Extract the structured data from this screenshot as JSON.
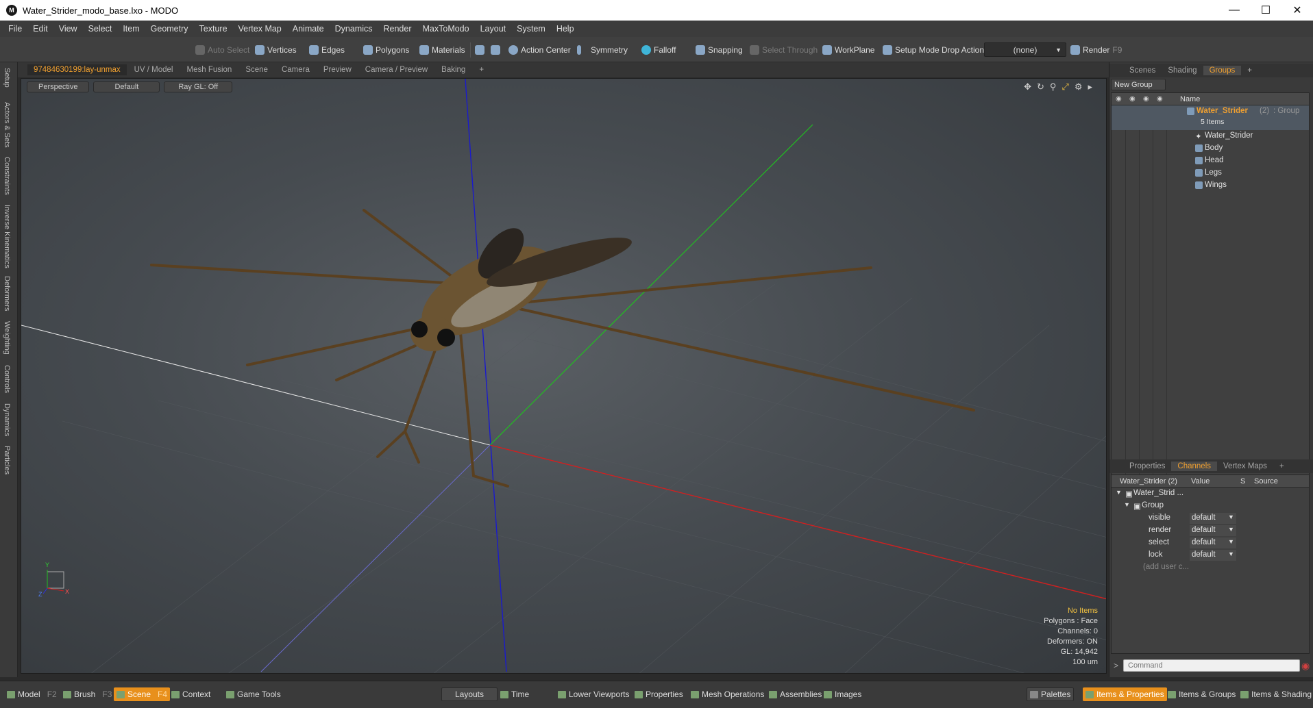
{
  "window": {
    "title": "Water_Strider_modo_base.lxo - MODO",
    "logo": "M"
  },
  "menu": [
    "File",
    "Edit",
    "View",
    "Select",
    "Item",
    "Geometry",
    "Texture",
    "Vertex Map",
    "Animate",
    "Dynamics",
    "Render",
    "MaxToModo",
    "Layout",
    "System",
    "Help"
  ],
  "toolbar": {
    "auto_select": "Auto Select",
    "vertices": "Vertices",
    "edges": "Edges",
    "polygons": "Polygons",
    "materials": "Materials",
    "action_center": "Action Center",
    "symmetry": "Symmetry",
    "falloff": "Falloff",
    "snapping": "Snapping",
    "select_through": "Select Through",
    "workplane": "WorkPlane",
    "setup_mode": "Setup Mode",
    "drop_action": "Drop Action",
    "drop_value": "(none)",
    "render": "Render",
    "render_key": "F9"
  },
  "left_tabs": [
    "Setup",
    "Actors & Sets",
    "Constraints",
    "Inverse Kinematics",
    "Deformers",
    "Weighting",
    "Controls",
    "Dynamics",
    "Particles"
  ],
  "viewport_tabs": [
    "97484630199:lay-unmax",
    "UV / Model",
    "Mesh Fusion",
    "Scene",
    "Camera",
    "Preview",
    "Camera / Preview",
    "Baking",
    "+"
  ],
  "viewport": {
    "view": "Perspective",
    "shading": "Default",
    "raygl": "Ray GL: Off",
    "info": {
      "items": "No Items",
      "polygons": "Polygons : Face",
      "channels": "Channels: 0",
      "deformers": "Deformers: ON",
      "gl": "GL: 14,942",
      "unit": "100 um"
    },
    "axis_labels": {
      "y": "Y",
      "z": "Z",
      "x": "X"
    }
  },
  "right_panel": {
    "top_tabs": [
      "Scenes",
      "Shading",
      "Groups",
      "+"
    ],
    "new_group": "New Group",
    "tree_header": "Name",
    "group": {
      "name": "Water_Strider",
      "count": "(2)",
      "type": ": Group",
      "sub": "5 Items"
    },
    "items": [
      "Water_Strider",
      "Body",
      "Head",
      "Legs",
      "Wings"
    ],
    "bottom_tabs": [
      "Properties",
      "Channels",
      "Vertex Maps",
      "+"
    ],
    "channels": {
      "header": {
        "name": "Water_Strider (2)",
        "value": "Value",
        "s": "S",
        "source": "Source"
      },
      "root": "Water_Strid ...",
      "group": "Group",
      "rows": [
        {
          "name": "visible",
          "value": "default"
        },
        {
          "name": "render",
          "value": "default"
        },
        {
          "name": "select",
          "value": "default"
        },
        {
          "name": "lock",
          "value": "default"
        }
      ],
      "add": "(add user c..."
    },
    "command_placeholder": "Command"
  },
  "bottom": {
    "model": "Model",
    "model_key": "F2",
    "brush": "Brush",
    "brush_key": "F3",
    "scene": "Scene",
    "scene_key": "F4",
    "context": "Context",
    "game_tools": "Game Tools",
    "layouts": "Layouts",
    "time": "Time",
    "lower_viewports": "Lower Viewports",
    "properties": "Properties",
    "mesh_operations": "Mesh Operations",
    "assemblies": "Assemblies",
    "images": "Images",
    "palettes": "Palettes",
    "items_properties": "Items & Properties",
    "items_groups": "Items & Groups",
    "items_shading": "Items & Shading"
  },
  "colors": {
    "accent": "#f0a030",
    "active_tab": "#e8901c",
    "x_axis": "#d02020",
    "y_axis": "#20c020",
    "z_axis": "#2020d0"
  }
}
